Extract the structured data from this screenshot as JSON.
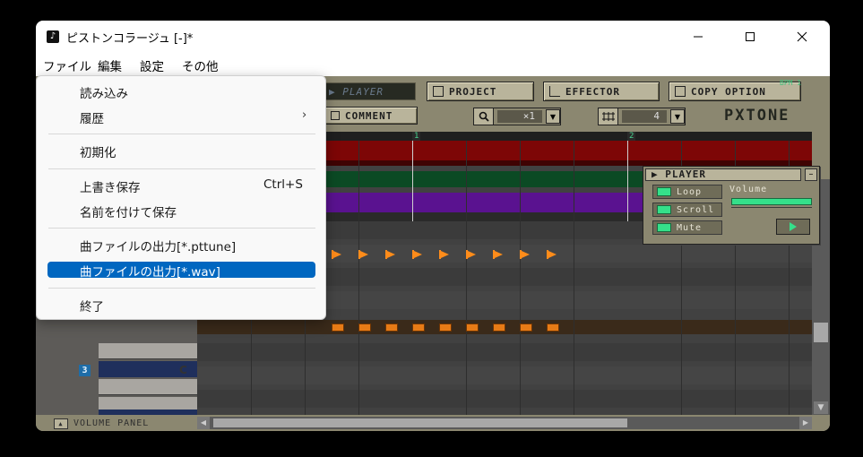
{
  "window": {
    "app_icon": "♪",
    "title": "ピストンコラージュ [-]*",
    "minimize_glyph": "—",
    "maximize_glyph": "☐",
    "close_glyph": "✕"
  },
  "menubar": {
    "items": [
      "ファイル",
      "編集",
      "設定",
      "その他"
    ]
  },
  "file_menu": {
    "items": [
      {
        "label": "読み込み"
      },
      {
        "label": "履歴",
        "submenu_arrow": "›"
      },
      {
        "label": "初期化"
      },
      {
        "label": "上書き保存",
        "shortcut": "Ctrl+S"
      },
      {
        "label": "名前を付けて保存"
      },
      {
        "label": "曲ファイルの出力[*.pttune]"
      },
      {
        "label": "曲ファイルの出力[*.wav]",
        "highlighted": true
      },
      {
        "label": "終了"
      }
    ]
  },
  "toolbar": {
    "player_tab": "▶ PLAYER",
    "project": "PROJECT",
    "effector": "EFFECTOR",
    "copy_option": "COPY OPTION",
    "comment": "COMMENT",
    "zoom_value": "×1",
    "division_value": "4",
    "top_right_text": "BPM  1"
  },
  "logo": "PXTONE",
  "ruler": {
    "marks": [
      "1",
      "2"
    ]
  },
  "keyboard": {
    "octave_label": "3",
    "key_label": "C"
  },
  "player_panel": {
    "title": "PLAYER",
    "close_glyph": "–",
    "loop": "Loop",
    "scroll": "Scroll",
    "mute": "Mute",
    "volume_label": "Volume",
    "volume_level": 1.0,
    "play_glyph": "▶"
  },
  "bottom": {
    "volume_panel": "VOLUME PANEL"
  },
  "colors": {
    "accent_highlight": "#0067c0",
    "unit_red": "#7d0606",
    "unit_green": "#0b4a24",
    "unit_purple": "#5a1290",
    "note_orange": "#e77b16",
    "led_green": "#35e08a"
  }
}
